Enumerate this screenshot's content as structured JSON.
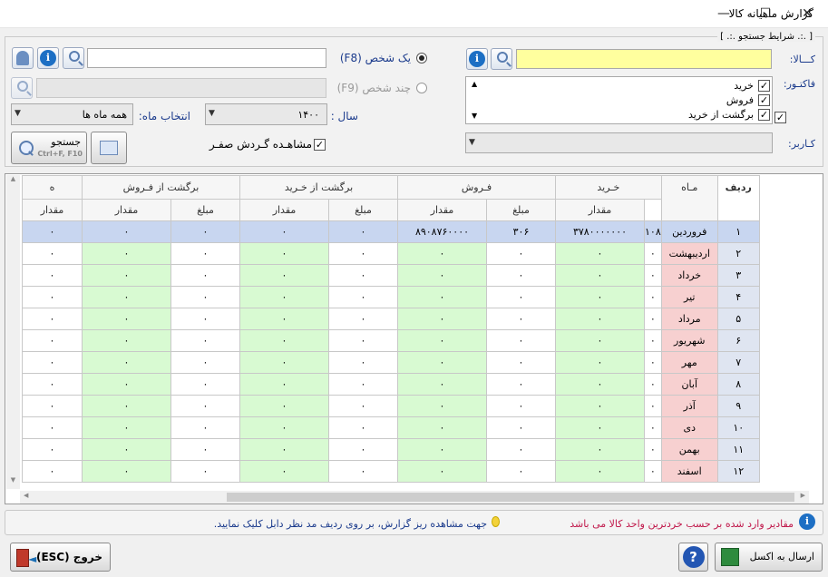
{
  "window": {
    "title": "گزارش ماهیانه کالا"
  },
  "panel": {
    "legend": "[ .:. شرایط جستجو .:. ]"
  },
  "product": {
    "label": "کـــالا:",
    "value": ""
  },
  "factor": {
    "label": "فاکتـور:",
    "items": [
      {
        "label": "خرید",
        "checked": true
      },
      {
        "label": "فروش",
        "checked": true
      },
      {
        "label": "برگشت از خرید",
        "checked": true
      }
    ],
    "extra_checked": true
  },
  "user": {
    "label": "کـاربر:",
    "value": ""
  },
  "person": {
    "one_label": "یک شخص (F8)",
    "many_label": "چند شخص (F9)",
    "selected": "one",
    "value": ""
  },
  "year": {
    "label": "سال :",
    "value": "۱۴۰۰"
  },
  "month": {
    "label": "انتخاب ماه:",
    "value": "همه ماه ها"
  },
  "zero_turnover": {
    "label": "مشاهـده گـردش صفـر",
    "checked": true
  },
  "search_button": {
    "label": "جستجو",
    "shortcut": "Ctrl+F, F10"
  },
  "table": {
    "row_header": "ردیف",
    "month_header": "مـاه",
    "groups": [
      "خـرید",
      "فـروش",
      "برگشت از خـرید",
      "برگشت از فـروش",
      "ه"
    ],
    "subheaders": {
      "qty": "مقدار",
      "amount": "مبلغ"
    },
    "rows": [
      {
        "n": "۱",
        "m": "فروردین",
        "c": [
          "۱۰۸",
          "۳۷۸۰۰۰۰۰۰۰",
          "۳۰۶",
          "۸۹۰۸۷۶۰۰۰۰",
          "۰",
          "۰",
          "۰",
          "۰",
          "۰"
        ]
      },
      {
        "n": "۲",
        "m": "اردیبهشت",
        "c": [
          "۰",
          "۰",
          "۰",
          "۰",
          "۰",
          "۰",
          "۰",
          "۰",
          "۰"
        ]
      },
      {
        "n": "۳",
        "m": "خرداد",
        "c": [
          "۰",
          "۰",
          "۰",
          "۰",
          "۰",
          "۰",
          "۰",
          "۰",
          "۰"
        ]
      },
      {
        "n": "۴",
        "m": "تیر",
        "c": [
          "۰",
          "۰",
          "۰",
          "۰",
          "۰",
          "۰",
          "۰",
          "۰",
          "۰"
        ]
      },
      {
        "n": "۵",
        "m": "مرداد",
        "c": [
          "۰",
          "۰",
          "۰",
          "۰",
          "۰",
          "۰",
          "۰",
          "۰",
          "۰"
        ]
      },
      {
        "n": "۶",
        "m": "شهریور",
        "c": [
          "۰",
          "۰",
          "۰",
          "۰",
          "۰",
          "۰",
          "۰",
          "۰",
          "۰"
        ]
      },
      {
        "n": "۷",
        "m": "مهر",
        "c": [
          "۰",
          "۰",
          "۰",
          "۰",
          "۰",
          "۰",
          "۰",
          "۰",
          "۰"
        ]
      },
      {
        "n": "۸",
        "m": "آبان",
        "c": [
          "۰",
          "۰",
          "۰",
          "۰",
          "۰",
          "۰",
          "۰",
          "۰",
          "۰"
        ]
      },
      {
        "n": "۹",
        "m": "آذر",
        "c": [
          "۰",
          "۰",
          "۰",
          "۰",
          "۰",
          "۰",
          "۰",
          "۰",
          "۰"
        ]
      },
      {
        "n": "۱۰",
        "m": "دی",
        "c": [
          "۰",
          "۰",
          "۰",
          "۰",
          "۰",
          "۰",
          "۰",
          "۰",
          "۰"
        ]
      },
      {
        "n": "۱۱",
        "m": "بهمن",
        "c": [
          "۰",
          "۰",
          "۰",
          "۰",
          "۰",
          "۰",
          "۰",
          "۰",
          "۰"
        ]
      },
      {
        "n": "۱۲",
        "m": "اسفند",
        "c": [
          "۰",
          "۰",
          "۰",
          "۰",
          "۰",
          "۰",
          "۰",
          "۰",
          "۰"
        ]
      }
    ]
  },
  "status": {
    "info": "مقادیر وارد شده بر حسب خردترین واحد کالا می باشد",
    "hint": "جهت مشاهده ریز گزارش، بر روی ردیف  مد نظر دابل کلیک نمایید."
  },
  "buttons": {
    "exit": "خروج (ESC)",
    "excel": "ارسال به اکسل",
    "help": "?"
  }
}
